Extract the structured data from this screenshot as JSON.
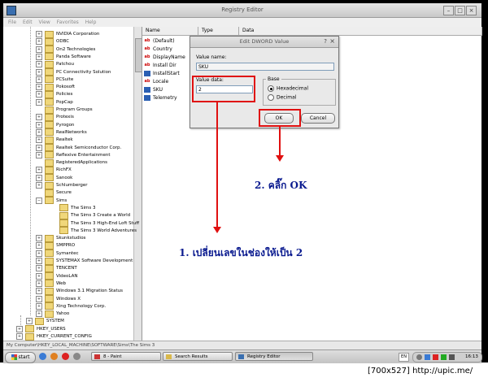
{
  "window": {
    "title": "Registry Editor",
    "menu": [
      "File",
      "Edit",
      "View",
      "Favorites",
      "Help"
    ],
    "controls": [
      "–",
      "□",
      "×"
    ]
  },
  "tree": [
    {
      "label": "NVIDIA Corporation",
      "exp": "+"
    },
    {
      "label": "ODBC",
      "exp": "+"
    },
    {
      "label": "On2 Technologies",
      "exp": "+"
    },
    {
      "label": "Panda Software",
      "exp": "+"
    },
    {
      "label": "Patchou",
      "exp": "+"
    },
    {
      "label": "PC Connectivity Solution",
      "exp": "+"
    },
    {
      "label": "PCSuite",
      "exp": "+"
    },
    {
      "label": "Pokosoft",
      "exp": "+"
    },
    {
      "label": "Policies",
      "exp": "+"
    },
    {
      "label": "PopCap",
      "exp": "+"
    },
    {
      "label": "Program Groups",
      "exp": ""
    },
    {
      "label": "Protexis",
      "exp": "+"
    },
    {
      "label": "Pyrogon",
      "exp": "+"
    },
    {
      "label": "RealNetworks",
      "exp": "+"
    },
    {
      "label": "Realtek",
      "exp": "+"
    },
    {
      "label": "Realtek Semiconductor Corp.",
      "exp": "+"
    },
    {
      "label": "Reflexive Entertainment",
      "exp": "+"
    },
    {
      "label": "RegisteredApplications",
      "exp": ""
    },
    {
      "label": "RichFX",
      "exp": "+"
    },
    {
      "label": "Sanook",
      "exp": "+"
    },
    {
      "label": "Schlumberger",
      "exp": "+"
    },
    {
      "label": "Secure",
      "exp": ""
    },
    {
      "label": "Sims",
      "exp": "−"
    },
    {
      "label": "The Sims 3",
      "exp": "",
      "indent": 1
    },
    {
      "label": "The Sims 3 Create a World",
      "exp": "",
      "indent": 1
    },
    {
      "label": "The Sims 3 High-End Loft Stuff",
      "exp": "",
      "indent": 1
    },
    {
      "label": "The Sims 3 World Adventures",
      "exp": "",
      "indent": 1
    },
    {
      "label": "Skunkstudios",
      "exp": "+"
    },
    {
      "label": "SMPPRO",
      "exp": "+"
    },
    {
      "label": "Symantec",
      "exp": "+"
    },
    {
      "label": "SYSTEMAX Software Development",
      "exp": "+"
    },
    {
      "label": "TENCENT",
      "exp": "+"
    },
    {
      "label": "VideoLAN",
      "exp": "+"
    },
    {
      "label": "Web",
      "exp": "+"
    },
    {
      "label": "Windows 3.1 Migration Status",
      "exp": "+"
    },
    {
      "label": "Windows X",
      "exp": "+"
    },
    {
      "label": "Xing Technology Corp.",
      "exp": "+"
    },
    {
      "label": "Yahoo",
      "exp": "+"
    },
    {
      "label": "SYSTEM",
      "exp": "+",
      "indent": -1
    },
    {
      "label": "HKEY_USERS",
      "exp": "+",
      "indent": -2
    },
    {
      "label": "HKEY_CURRENT_CONFIG",
      "exp": "+",
      "indent": -2
    }
  ],
  "columns": [
    "Name",
    "Type",
    "Data"
  ],
  "values": [
    {
      "name": "(Default)",
      "kind": "ab"
    },
    {
      "name": "Country",
      "kind": "ab"
    },
    {
      "name": "DisplayName",
      "kind": "ab"
    },
    {
      "name": "Install Dir",
      "kind": "ab"
    },
    {
      "name": "InstallStart",
      "kind": "bin"
    },
    {
      "name": "Locale",
      "kind": "ab"
    },
    {
      "name": "SKU",
      "kind": "bin"
    },
    {
      "name": "Telemetry",
      "kind": "bin"
    }
  ],
  "status_path": "My Computer\\HKEY_LOCAL_MACHINE\\SOFTWARE\\Sims\\The Sims 3",
  "dialog": {
    "title": "Edit DWORD Value",
    "help": "?",
    "close": "×",
    "value_name_label": "Value name:",
    "value_name": "SKU",
    "value_data_label": "Value data:",
    "value_data": "2",
    "base_label": "Base",
    "hex_label": "Hexadecimal",
    "dec_label": "Decimal",
    "ok_label": "OK",
    "cancel_label": "Cancel"
  },
  "annotations": {
    "step1": "1. เปลี่ยนเลขในช่องให้เป็น 2",
    "step2": "2. คลิ๊ก OK",
    "color": "#e01010",
    "text_color": "#0a1a8f"
  },
  "taskbar": {
    "start": "start",
    "tasks": [
      "8 - Paint",
      "Search Results",
      "Registry Editor"
    ],
    "lang": "EN",
    "clock": "16:13"
  },
  "watermark": "[700x527] http://upic.me/"
}
